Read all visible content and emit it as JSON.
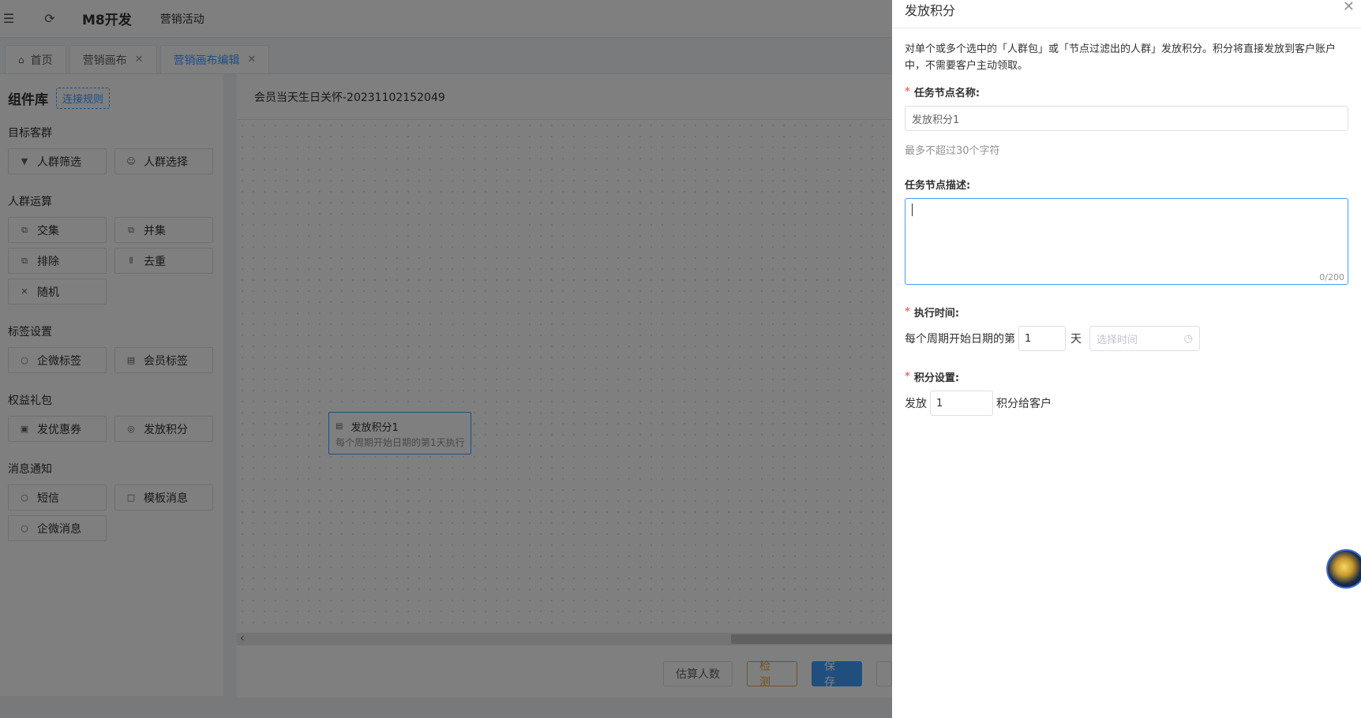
{
  "topbar": {
    "app_title": "M8开发",
    "breadcrumb": "营销活动",
    "icons": [
      "menu-icon",
      "refresh-icon"
    ]
  },
  "tabs": [
    {
      "label": "首页",
      "icon": "home-icon",
      "closable": false,
      "active": false
    },
    {
      "label": "营销画布",
      "closable": true,
      "active": false
    },
    {
      "label": "营销画布编辑",
      "closable": true,
      "active": true
    }
  ],
  "library": {
    "title": "组件库",
    "link": "连接规则",
    "groups": [
      {
        "label": "目标客群",
        "items": [
          {
            "label": "人群筛选",
            "icon": "filter-icon"
          },
          {
            "label": "人群选择",
            "icon": "user-icon"
          }
        ]
      },
      {
        "label": "人群运算",
        "items": [
          {
            "label": "交集",
            "icon": "intersect-icon"
          },
          {
            "label": "并集",
            "icon": "union-icon"
          },
          {
            "label": "排除",
            "icon": "exclude-icon"
          },
          {
            "label": "去重",
            "icon": "dedupe-icon"
          },
          {
            "label": "随机",
            "icon": "shuffle-icon"
          }
        ]
      },
      {
        "label": "标签设置",
        "items": [
          {
            "label": "企微标签",
            "icon": "chat-tag-icon"
          },
          {
            "label": "会员标签",
            "icon": "member-tag-icon"
          }
        ]
      },
      {
        "label": "权益礼包",
        "items": [
          {
            "label": "发优惠券",
            "icon": "coupon-icon"
          },
          {
            "label": "发放积分",
            "icon": "points-icon"
          }
        ]
      },
      {
        "label": "消息通知",
        "items": [
          {
            "label": "短信",
            "icon": "sms-icon"
          },
          {
            "label": "模板消息",
            "icon": "template-message-icon"
          },
          {
            "label": "企微消息",
            "icon": "wecom-message-icon"
          }
        ]
      }
    ]
  },
  "canvas": {
    "title": "会员当天生日关怀-20231102152049",
    "node": {
      "title": "发放积分1",
      "desc": "每个周期开始日期的第1天执行"
    },
    "buttons": {
      "estimate": "估算人数",
      "check": "检 测",
      "save": "保 存"
    }
  },
  "drawer": {
    "title": "发放积分",
    "intro": "对单个或多个选中的「人群包」或「节点过滤出的人群」发放积分。积分将直接发放到客户账户中，不需要客户主动领取。",
    "name_label": "任务节点名称:",
    "name_value": "发放积分1",
    "name_hint": "最多不超过30个字符",
    "desc_label": "任务节点描述:",
    "desc_counter": "0/200",
    "time_label": "执行时间:",
    "time_prefix": "每个周期开始日期的第",
    "time_day_value": "1",
    "time_unit": "天",
    "time_placeholder": "选择时间",
    "points_label": "积分设置:",
    "points_prefix": "发放",
    "points_value": "1",
    "points_suffix": "积分给客户"
  }
}
